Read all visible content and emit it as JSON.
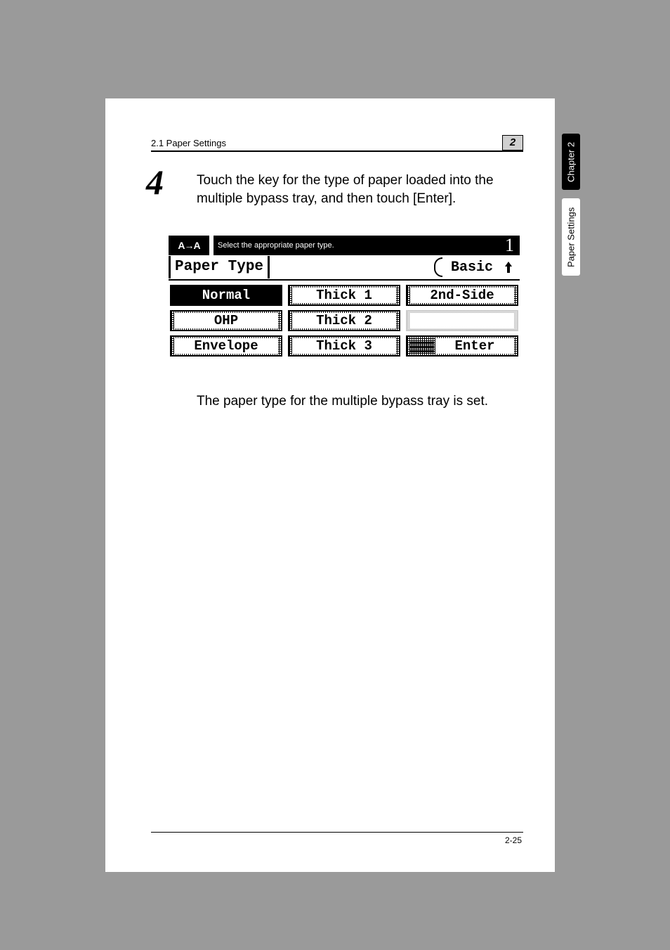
{
  "header": {
    "section": "2.1 Paper Settings",
    "chapter_badge": "2"
  },
  "step": {
    "number": "4",
    "text": "Touch the key for the type of paper loaded into the multiple bypass tray, and then touch [Enter]."
  },
  "lcd": {
    "icon_glyph": "A→A",
    "instruction": "Select the appropriate paper type.",
    "count": "1",
    "title": "Paper Type",
    "mode": "Basic",
    "buttons": {
      "r1c1": "Normal",
      "r1c2": "Thick 1",
      "r1c3": "2nd-Side",
      "r2c1": "OHP",
      "r2c2": "Thick 2",
      "r3c1": "Envelope",
      "r3c2": "Thick 3",
      "r3c3": "Enter"
    }
  },
  "result": "The paper type for the multiple bypass tray is set.",
  "side": {
    "chapter": "Chapter 2",
    "section": "Paper Settings"
  },
  "footer": {
    "page": "2-25"
  }
}
